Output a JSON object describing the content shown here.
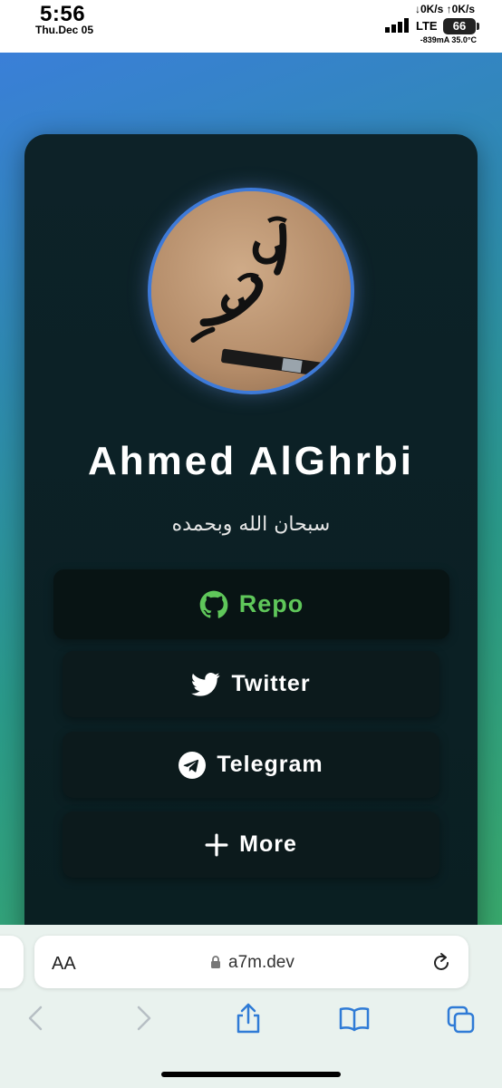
{
  "status_bar": {
    "time": "5:56",
    "date": "Thu.Dec 05",
    "net_speed": "↓0K/s ↑0K/s",
    "network": "LTE",
    "battery": "66",
    "power": "-839mA 35.0°C"
  },
  "profile": {
    "name": "Ahmed AlGhrbi",
    "subtitle": "سبحان الله وبحمده"
  },
  "links": [
    {
      "label": "Repo",
      "icon": "github-icon"
    },
    {
      "label": "Twitter",
      "icon": "twitter-icon"
    },
    {
      "label": "Telegram",
      "icon": "telegram-icon"
    },
    {
      "label": "More",
      "icon": "plus-icon"
    }
  ],
  "browser": {
    "text_size_label": "AA",
    "url": "a7m.dev"
  },
  "colors": {
    "accent_green": "#5fc75a",
    "avatar_ring": "#3e7ad8",
    "card_bg": "#0a1f22"
  }
}
